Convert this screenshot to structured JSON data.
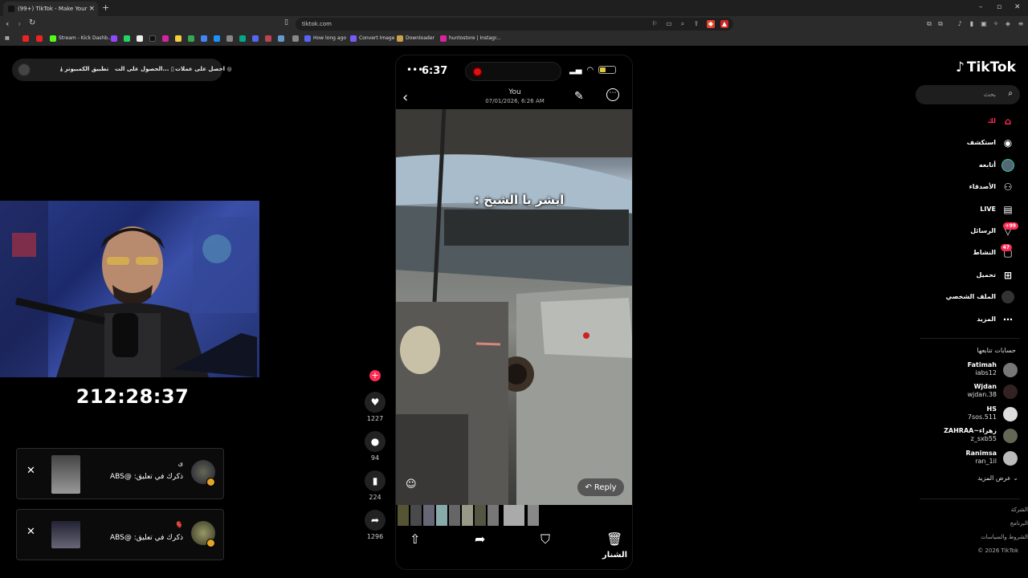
{
  "browser": {
    "tab_title": "(99+) TikTok - Make Your Day",
    "new_tab": "+",
    "url": "tiktok.com",
    "bookmarks": [
      "Stream - Kick Dashb...",
      "How long ago",
      "Convert Image",
      "Downloader",
      "huntostore | Instagr..."
    ]
  },
  "stream": {
    "app_pill": {
      "coins": "احصل على عملات",
      "get": "الحصول على الت...",
      "desktop_app": "تطبيق الكمبيوتر"
    },
    "timer": "212:28:37",
    "notifications": [
      {
        "title": "ى",
        "text": "ذكرك في تعليق: @ABS"
      },
      {
        "title": "🫀",
        "text": "ذكرك في تعليق: @ABS"
      }
    ],
    "close_glyph": "✕"
  },
  "actions": {
    "likes": "1227",
    "comments": "94",
    "saves": "224",
    "shares": "1296"
  },
  "phone": {
    "clock": "6:37",
    "sender": "You",
    "date": "07/01/2026, 6:26 AM",
    "caption": "ابشر يا الشيخ :",
    "reply_label": "Reply",
    "bottom_name": "الشنار",
    "battery_fraction": 0.35
  },
  "sidebar": {
    "logo": "TikTok",
    "search_placeholder": "بحث",
    "nav": [
      {
        "label": "لك",
        "icon": "home-icon"
      },
      {
        "label": "استكشف",
        "icon": "compass-icon"
      },
      {
        "label": "أتابعه",
        "icon": "following-avatar-icon"
      },
      {
        "label": "الأصدقاء",
        "icon": "friends-icon"
      },
      {
        "label": "LIVE",
        "icon": "live-icon"
      },
      {
        "label": "الرسائل",
        "icon": "messages-icon",
        "badge": "+99"
      },
      {
        "label": "النشاط",
        "icon": "activity-icon",
        "badge": "47"
      },
      {
        "label": "تحميل",
        "icon": "upload-icon"
      },
      {
        "label": "الملف الشخصي",
        "icon": "profile-icon"
      },
      {
        "label": "المزيد",
        "icon": "more-icon"
      }
    ],
    "following_header": "حسابات تتابعها",
    "following": [
      {
        "name": "Fatimah",
        "user": "iabs12"
      },
      {
        "name": "Wjdan",
        "user": "wjdan.38"
      },
      {
        "name": "HS",
        "user": "7sos.511"
      },
      {
        "name": "ZAHRAA~زهراء",
        "user": "z_sxb55"
      },
      {
        "name": "Ranimsa",
        "user": "ran_1il"
      }
    ],
    "see_more": "عرض المزيد",
    "footer": [
      "الشركة",
      "البرنامج",
      "الشروط والسياسات",
      "© 2026 TikTok"
    ],
    "accent": "#fe2c55"
  }
}
